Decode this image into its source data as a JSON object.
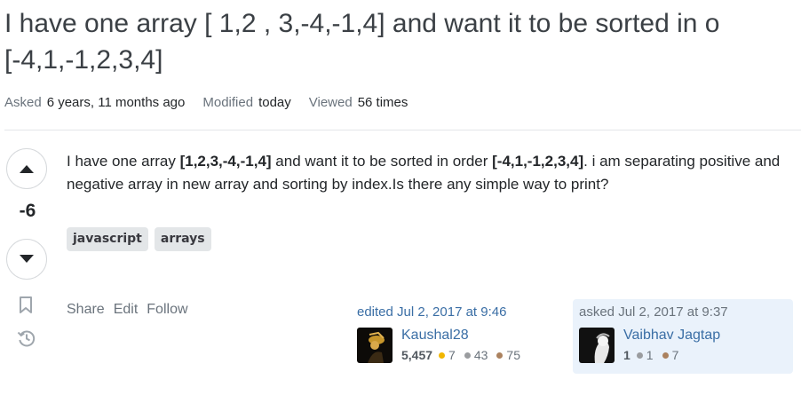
{
  "question": {
    "title_line1": "I have one array [ 1,2 , 3,-4,-1,4] and want it to be sorted in o",
    "title_line2": "[-4,1,-1,2,3,4]",
    "meta": {
      "asked_label": "Asked",
      "asked_value": "6 years, 11 months ago",
      "modified_label": "Modified",
      "modified_value": "today",
      "viewed_label": "Viewed",
      "viewed_value": "56 times"
    },
    "vote_count": "-6",
    "body": {
      "t1": "I have one array ",
      "b1": "[1,2,3,-4,-1,4]",
      "t2": " and want it to be sorted in order ",
      "b2": "[-4,1,-1,2,3,4]",
      "t3": ". i am separating positive and negative array in new array and sorting by index.Is there any simple way to print?"
    },
    "tags": [
      "javascript",
      "arrays"
    ],
    "actions": {
      "share": "Share",
      "edit": "Edit",
      "follow": "Follow"
    },
    "edited": {
      "when": "edited Jul 2, 2017 at 9:46",
      "user": "Kaushal28",
      "reputation": "5,457",
      "gold": "7",
      "silver": "43",
      "bronze": "75"
    },
    "asked": {
      "when": "asked Jul 2, 2017 at 9:37",
      "user": "Vaibhav Jagtap",
      "reputation": "1",
      "silver": "1",
      "bronze": "7"
    }
  },
  "icons": {
    "upvote": "arrow-up-icon",
    "downvote": "arrow-down-icon",
    "bookmark": "bookmark-icon",
    "history": "history-icon"
  },
  "colors": {
    "link": "#3a6ea5",
    "asked_card_bg": "#eaf2fb",
    "tag_bg": "#e3e6e8",
    "gold": "#f1b600",
    "silver": "#9a9c9f",
    "bronze": "#ab825f"
  }
}
